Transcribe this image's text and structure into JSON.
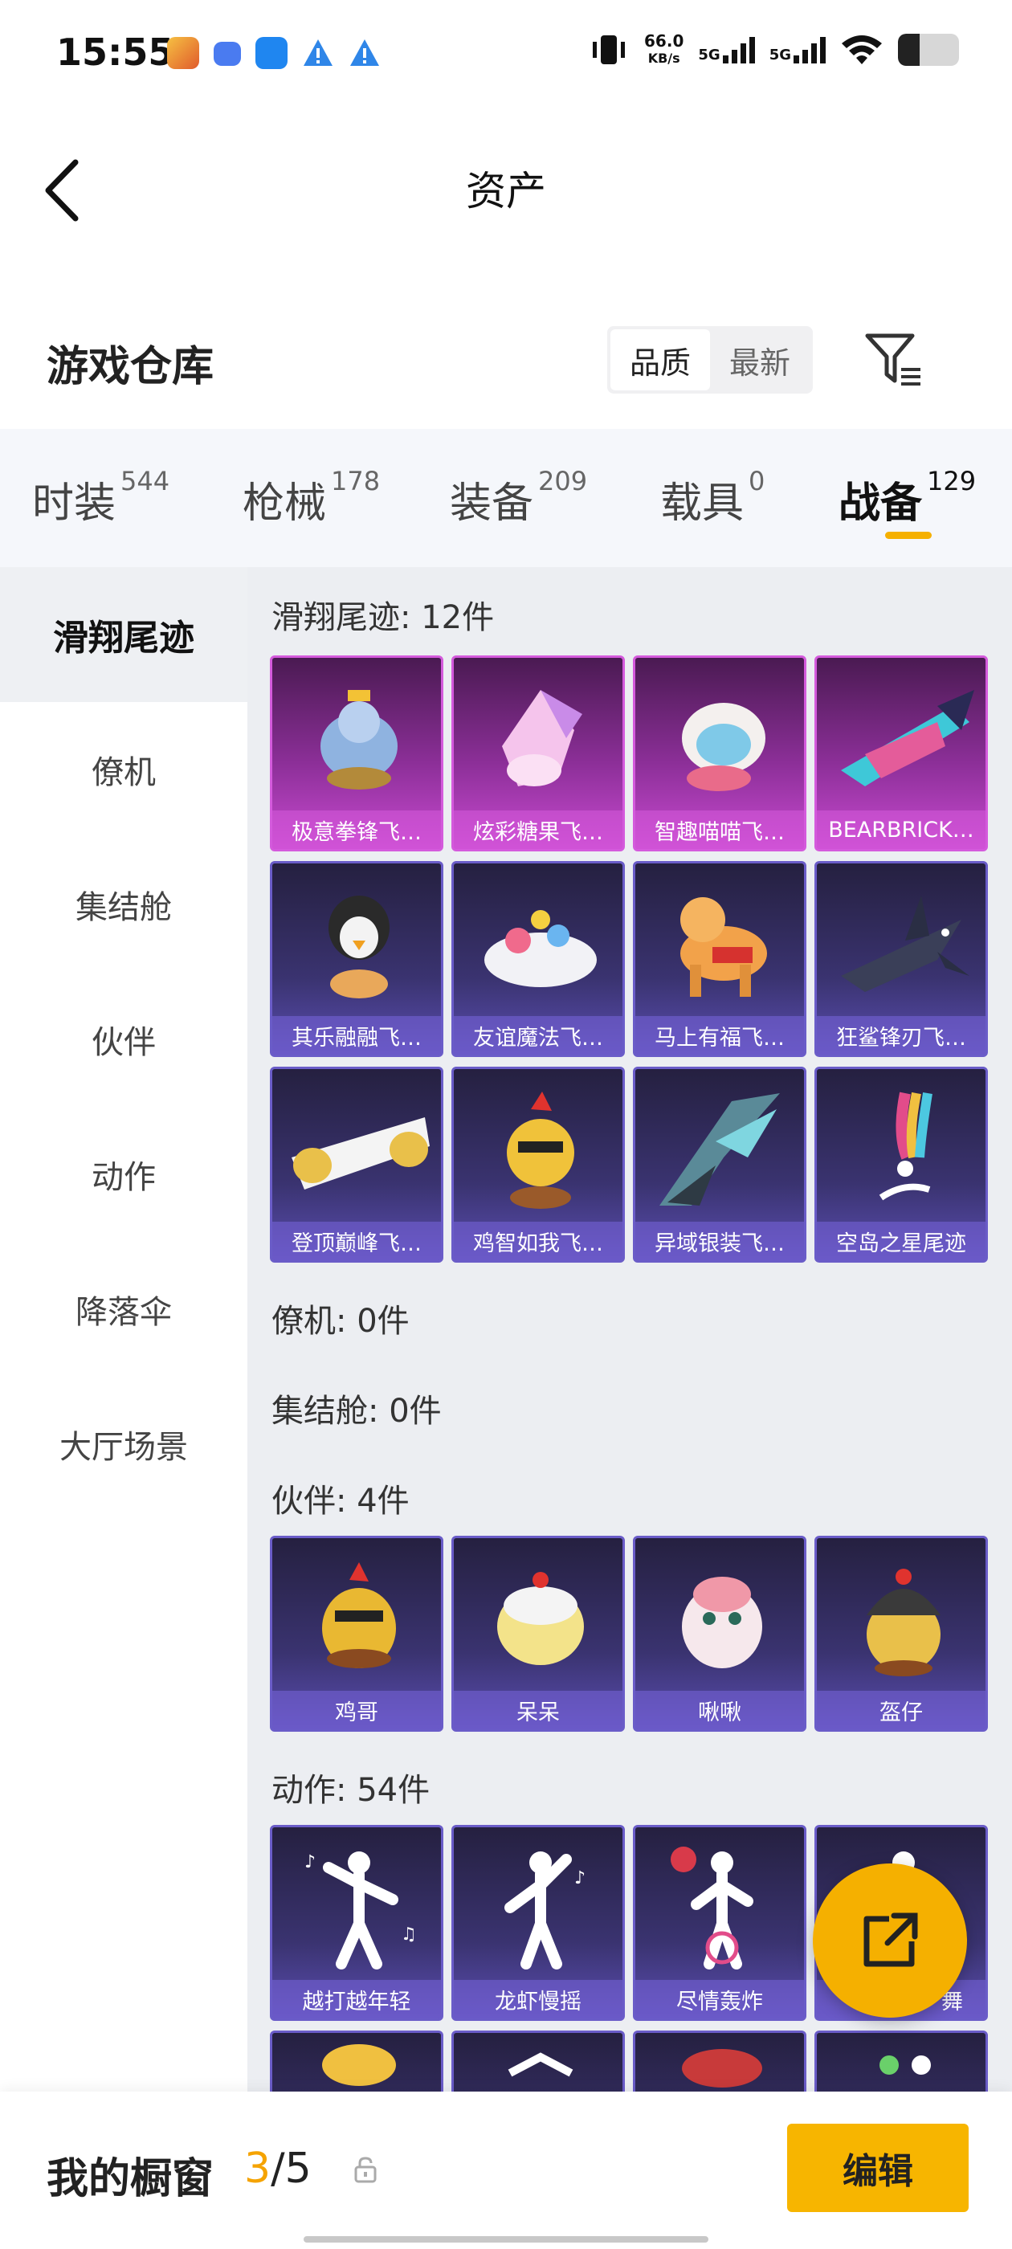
{
  "status_bar": {
    "time": "15:55",
    "net_speed_value": "66.0",
    "net_speed_unit": "KB/s",
    "signal1": "5G",
    "signal2": "5G",
    "battery_level": 0.35
  },
  "header": {
    "title": "资产"
  },
  "warehouse": {
    "title": "游戏仓库",
    "sort_options": [
      "品质",
      "最新"
    ],
    "active_sort": "品质"
  },
  "tabs": [
    {
      "label": "时装",
      "count": "544"
    },
    {
      "label": "枪械",
      "count": "178"
    },
    {
      "label": "装备",
      "count": "209"
    },
    {
      "label": "载具",
      "count": "0"
    },
    {
      "label": "战备",
      "count": "129"
    }
  ],
  "sidebar": [
    "滑翔尾迹",
    "僚机",
    "集结舱",
    "伙伴",
    "动作",
    "降落伞",
    "大厅场景"
  ],
  "sections": {
    "glide": {
      "title": "滑翔尾迹: 12件",
      "items": [
        "极意拳锋飞…",
        "炫彩糖果飞…",
        "智趣喵喵飞…",
        "BEARBRICK…",
        "其乐融融飞…",
        "友谊魔法飞…",
        "马上有福飞…",
        "狂鲨锋刃飞…",
        "登顶巅峰飞…",
        "鸡智如我飞…",
        "异域银装飞…",
        "空岛之星尾迹"
      ]
    },
    "wingman": {
      "title": "僚机: 0件"
    },
    "assembly": {
      "title": "集结舱: 0件"
    },
    "partner": {
      "title": "伙伴: 4件",
      "items": [
        "鸡哥",
        "呆呆",
        "啾啾",
        "盔仔"
      ]
    },
    "action": {
      "title": "动作: 54件",
      "items": [
        "越打越年轻",
        "龙虾慢摇",
        "尽情轰炸",
        "舞"
      ]
    }
  },
  "bottom": {
    "label": "我的橱窗",
    "current": "3",
    "separator": "/",
    "total": "5",
    "edit_label": "编辑"
  },
  "colors": {
    "accent": "#f5b000",
    "rare_pink": "#c84ad0",
    "epic_purple": "#5a4db0"
  }
}
